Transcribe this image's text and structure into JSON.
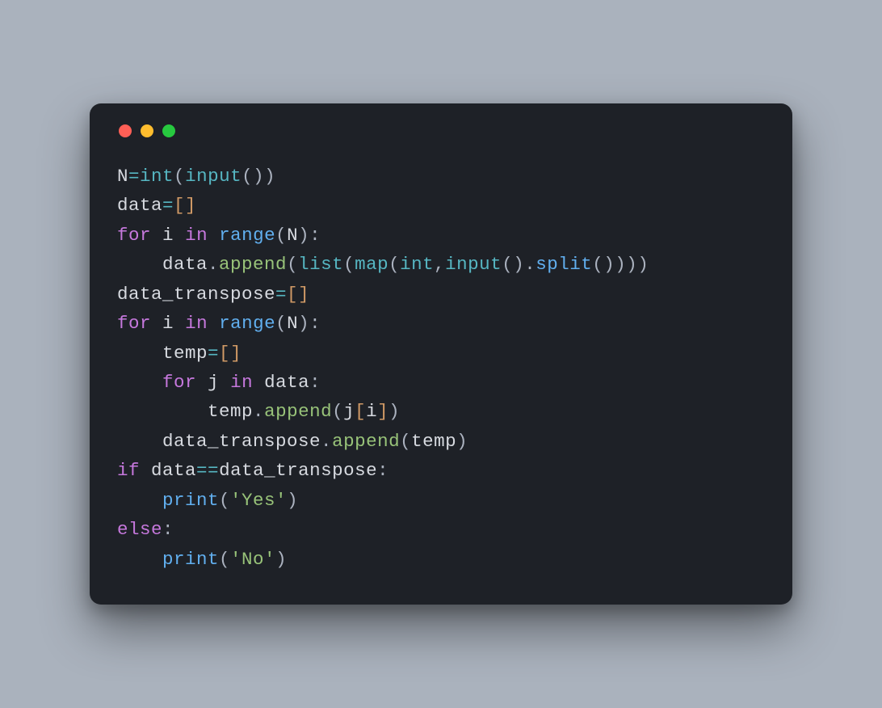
{
  "window": {
    "traffic_lights": [
      "red",
      "yellow",
      "green"
    ]
  },
  "code": {
    "tokens": [
      [
        {
          "t": "N",
          "c": "c-var"
        },
        {
          "t": "=",
          "c": "c-op"
        },
        {
          "t": "int",
          "c": "c-func"
        },
        {
          "t": "(",
          "c": "c-default"
        },
        {
          "t": "input",
          "c": "c-func"
        },
        {
          "t": "(",
          "c": "c-default"
        },
        {
          "t": ")",
          "c": "c-default"
        },
        {
          "t": ")",
          "c": "c-default"
        }
      ],
      [
        {
          "t": "data",
          "c": "c-var"
        },
        {
          "t": "=",
          "c": "c-op"
        },
        {
          "t": "[",
          "c": "c-bracket"
        },
        {
          "t": "]",
          "c": "c-bracket"
        }
      ],
      [
        {
          "t": "for",
          "c": "c-keyword"
        },
        {
          "t": " ",
          "c": "c-default"
        },
        {
          "t": "i",
          "c": "c-var"
        },
        {
          "t": " ",
          "c": "c-default"
        },
        {
          "t": "in",
          "c": "c-keyword"
        },
        {
          "t": " ",
          "c": "c-default"
        },
        {
          "t": "range",
          "c": "c-call"
        },
        {
          "t": "(",
          "c": "c-default"
        },
        {
          "t": "N",
          "c": "c-var"
        },
        {
          "t": ")",
          "c": "c-default"
        },
        {
          "t": ":",
          "c": "c-default"
        }
      ],
      [
        {
          "t": "    ",
          "c": "c-default"
        },
        {
          "t": "data",
          "c": "c-var"
        },
        {
          "t": ".",
          "c": "c-default"
        },
        {
          "t": "append",
          "c": "c-method"
        },
        {
          "t": "(",
          "c": "c-default"
        },
        {
          "t": "list",
          "c": "c-func"
        },
        {
          "t": "(",
          "c": "c-default"
        },
        {
          "t": "map",
          "c": "c-func"
        },
        {
          "t": "(",
          "c": "c-default"
        },
        {
          "t": "int",
          "c": "c-func"
        },
        {
          "t": ",",
          "c": "c-default"
        },
        {
          "t": "input",
          "c": "c-func"
        },
        {
          "t": "(",
          "c": "c-default"
        },
        {
          "t": ")",
          "c": "c-default"
        },
        {
          "t": ".",
          "c": "c-default"
        },
        {
          "t": "split",
          "c": "c-call"
        },
        {
          "t": "(",
          "c": "c-default"
        },
        {
          "t": ")",
          "c": "c-default"
        },
        {
          "t": ")",
          "c": "c-default"
        },
        {
          "t": ")",
          "c": "c-default"
        },
        {
          "t": ")",
          "c": "c-default"
        }
      ],
      [
        {
          "t": "data_transpose",
          "c": "c-var"
        },
        {
          "t": "=",
          "c": "c-op"
        },
        {
          "t": "[",
          "c": "c-bracket"
        },
        {
          "t": "]",
          "c": "c-bracket"
        }
      ],
      [
        {
          "t": "for",
          "c": "c-keyword"
        },
        {
          "t": " ",
          "c": "c-default"
        },
        {
          "t": "i",
          "c": "c-var"
        },
        {
          "t": " ",
          "c": "c-default"
        },
        {
          "t": "in",
          "c": "c-keyword"
        },
        {
          "t": " ",
          "c": "c-default"
        },
        {
          "t": "range",
          "c": "c-call"
        },
        {
          "t": "(",
          "c": "c-default"
        },
        {
          "t": "N",
          "c": "c-var"
        },
        {
          "t": ")",
          "c": "c-default"
        },
        {
          "t": ":",
          "c": "c-default"
        }
      ],
      [
        {
          "t": "    ",
          "c": "c-default"
        },
        {
          "t": "temp",
          "c": "c-var"
        },
        {
          "t": "=",
          "c": "c-op"
        },
        {
          "t": "[",
          "c": "c-bracket"
        },
        {
          "t": "]",
          "c": "c-bracket"
        }
      ],
      [
        {
          "t": "    ",
          "c": "c-default"
        },
        {
          "t": "for",
          "c": "c-keyword"
        },
        {
          "t": " ",
          "c": "c-default"
        },
        {
          "t": "j",
          "c": "c-var"
        },
        {
          "t": " ",
          "c": "c-default"
        },
        {
          "t": "in",
          "c": "c-keyword"
        },
        {
          "t": " ",
          "c": "c-default"
        },
        {
          "t": "data",
          "c": "c-var"
        },
        {
          "t": ":",
          "c": "c-default"
        }
      ],
      [
        {
          "t": "        ",
          "c": "c-default"
        },
        {
          "t": "temp",
          "c": "c-var"
        },
        {
          "t": ".",
          "c": "c-default"
        },
        {
          "t": "append",
          "c": "c-method"
        },
        {
          "t": "(",
          "c": "c-default"
        },
        {
          "t": "j",
          "c": "c-var"
        },
        {
          "t": "[",
          "c": "c-bracket"
        },
        {
          "t": "i",
          "c": "c-var"
        },
        {
          "t": "]",
          "c": "c-bracket"
        },
        {
          "t": ")",
          "c": "c-default"
        }
      ],
      [
        {
          "t": "    ",
          "c": "c-default"
        },
        {
          "t": "data_transpose",
          "c": "c-var"
        },
        {
          "t": ".",
          "c": "c-default"
        },
        {
          "t": "append",
          "c": "c-method"
        },
        {
          "t": "(",
          "c": "c-default"
        },
        {
          "t": "temp",
          "c": "c-var"
        },
        {
          "t": ")",
          "c": "c-default"
        }
      ],
      [
        {
          "t": "if",
          "c": "c-keyword"
        },
        {
          "t": " ",
          "c": "c-default"
        },
        {
          "t": "data",
          "c": "c-var"
        },
        {
          "t": "==",
          "c": "c-op"
        },
        {
          "t": "data_transpose",
          "c": "c-var"
        },
        {
          "t": ":",
          "c": "c-default"
        }
      ],
      [
        {
          "t": "    ",
          "c": "c-default"
        },
        {
          "t": "print",
          "c": "c-call"
        },
        {
          "t": "(",
          "c": "c-default"
        },
        {
          "t": "'Yes'",
          "c": "c-string"
        },
        {
          "t": ")",
          "c": "c-default"
        }
      ],
      [
        {
          "t": "else",
          "c": "c-keyword"
        },
        {
          "t": ":",
          "c": "c-default"
        }
      ],
      [
        {
          "t": "    ",
          "c": "c-default"
        },
        {
          "t": "print",
          "c": "c-call"
        },
        {
          "t": "(",
          "c": "c-default"
        },
        {
          "t": "'No'",
          "c": "c-string"
        },
        {
          "t": ")",
          "c": "c-default"
        }
      ]
    ]
  }
}
